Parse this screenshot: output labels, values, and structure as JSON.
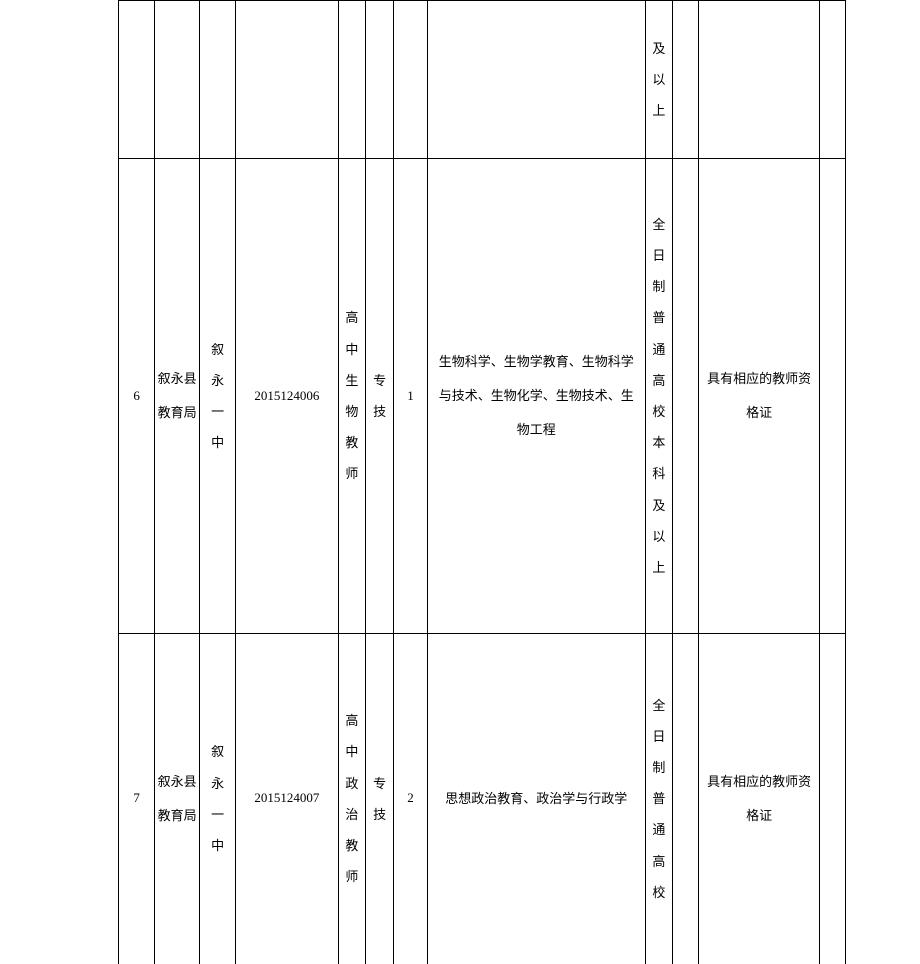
{
  "rows": [
    {
      "idx": "",
      "dept": "",
      "unit": "",
      "code": "",
      "position": "",
      "type": "",
      "qty": "",
      "major": "",
      "education": "及以上",
      "degree": "",
      "requirement": "",
      "last": ""
    },
    {
      "idx": "6",
      "dept": "叙永县教育局",
      "unit": "叙永一中",
      "code": "2015124006",
      "position": "高中生物教师",
      "type": "专技",
      "qty": "1",
      "major": "生物科学、生物学教育、生物科学与技术、生物化学、生物技术、生物工程",
      "education": "全日制普通高校本科及以上",
      "degree": "",
      "requirement": "具有相应的教师资格证",
      "last": ""
    },
    {
      "idx": "7",
      "dept": "叙永县教育局",
      "unit": "叙永一中",
      "code": "2015124007",
      "position": "高中政治教师",
      "type": "专技",
      "qty": "2",
      "major": "思想政治教育、政治学与行政学",
      "education": "全日制普通高校",
      "degree": "",
      "requirement": "具有相应的教师资格证",
      "last": ""
    }
  ]
}
